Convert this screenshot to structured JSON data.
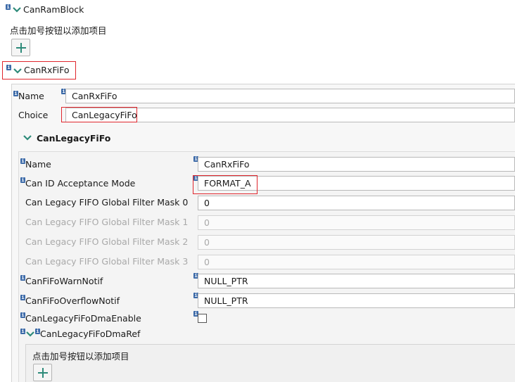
{
  "ram_block": {
    "title": "CanRamBlock",
    "hint": "点击加号按钮以添加项目"
  },
  "rx_fifo": {
    "title": "CanRxFiFo",
    "name_label": "Name",
    "name_value": "CanRxFiFo",
    "choice_label": "Choice",
    "choice_value": "CanLegacyFiFo"
  },
  "legacy_fifo": {
    "title": "CanLegacyFiFo",
    "fields": [
      {
        "label": "Name",
        "value": "CanRxFiFo"
      },
      {
        "label": "Can ID Acceptance Mode",
        "value": "FORMAT_A"
      },
      {
        "label": "Can Legacy FIFO Global Filter Mask 0",
        "value": "0"
      },
      {
        "label": "Can Legacy FIFO Global Filter Mask 1",
        "value": "0"
      },
      {
        "label": "Can Legacy FIFO Global Filter Mask 2",
        "value": "0"
      },
      {
        "label": "Can Legacy FIFO Global Filter Mask 3",
        "value": "0"
      },
      {
        "label": "CanFiFoWarnNotif",
        "value": "NULL_PTR"
      },
      {
        "label": "CanFiFoOverflowNotif",
        "value": "NULL_PTR"
      },
      {
        "label": "CanLegacyFiFoDmaEnable",
        "value": ""
      }
    ],
    "dma_ref": {
      "title": "CanLegacyFiFoDmaRef",
      "hint": "点击加号按钮以添加项目"
    }
  },
  "icons": {
    "info": "info-icon",
    "expand": "chevron-down-icon",
    "add": "plus-icon"
  },
  "colors": {
    "accent": "#2e8b7a",
    "info_badge": "#3c6aa8",
    "highlight": "#e0262d"
  }
}
